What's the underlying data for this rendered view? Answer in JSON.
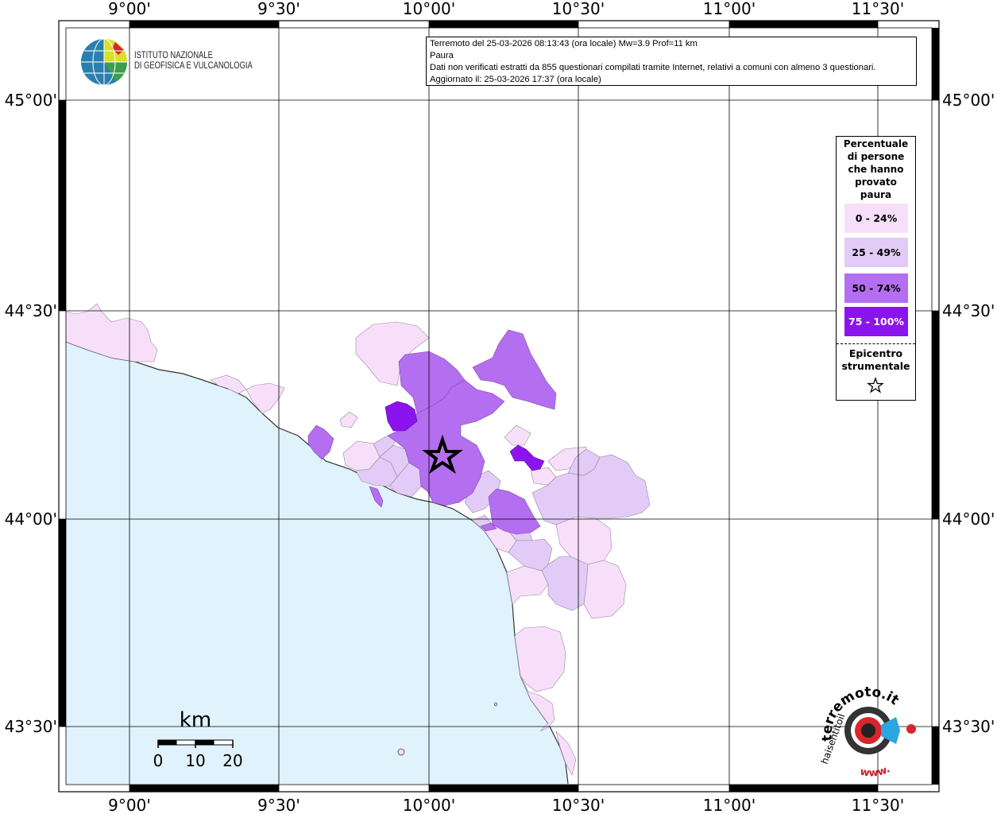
{
  "map": {
    "x_ticks": [
      "9°00'",
      "9°30'",
      "10°00'",
      "10°30'",
      "11°00'",
      "11°30'"
    ],
    "y_ticks": [
      "45°00'",
      "44°30'",
      "44°00'",
      "43°30'"
    ],
    "colors": {
      "sea": "#e0f2fb",
      "land": "#ffffff",
      "c0": "#f7dffa",
      "c1": "#e2cbf6",
      "c2": "#b46ef0",
      "c3": "#8b14ee"
    }
  },
  "info": {
    "line1": "Terremoto del 25-03-2026 08:13:43 (ora locale) Mw=3.9 Prof=11 km",
    "line2": "Paura",
    "line3": "Dati non verificati estratti da 855 questionari compilati tramite Internet, relativi a comuni con almeno 3 questionari.",
    "line4": "Aggiornato il: 25-03-2026 17:37 (ora locale)"
  },
  "logo": {
    "line1": "ISTITUTO NAZIONALE",
    "line2": "DI GEOFISICA E VULCANOLOGIA"
  },
  "legend": {
    "title_lines": [
      "Percentuale",
      "di persone",
      "che hanno",
      "provato",
      "paura"
    ],
    "items": [
      {
        "label": "0 - 24%",
        "color": "#f7dffa"
      },
      {
        "label": "25 - 49%",
        "color": "#e2cbf6"
      },
      {
        "label": "50 - 74%",
        "color": "#b46ef0"
      },
      {
        "label": "75 - 100%",
        "color": "#8b14ee"
      }
    ],
    "epicenter_lines": [
      "Epicentro",
      "strumentale"
    ]
  },
  "scalebar": {
    "unit": "km",
    "labels": [
      "0",
      "10",
      "20"
    ]
  },
  "hsit_logo": {
    "text_top": "terremoto.it",
    "text_left": "haisentitoil",
    "text_bottom": "www."
  }
}
